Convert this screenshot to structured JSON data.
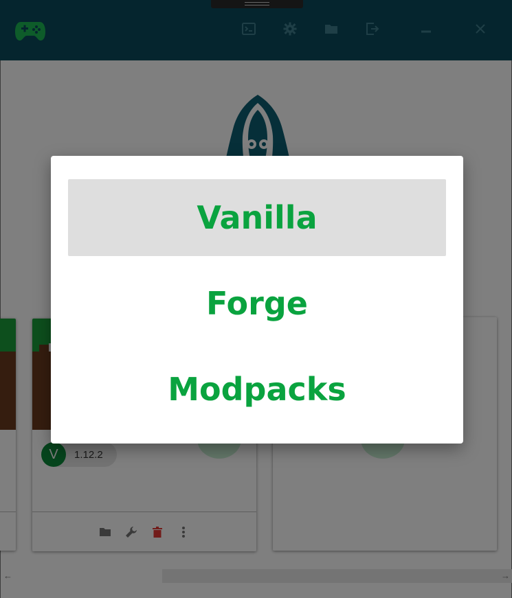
{
  "titlebar": {
    "icons": [
      "gamepad-icon",
      "terminal-icon",
      "gear-icon",
      "folder-icon",
      "logout-icon",
      "minimize-icon",
      "close-icon"
    ]
  },
  "instances": {
    "version_avatar": "V",
    "version": "1.12.2"
  },
  "dialog": {
    "options": [
      {
        "label": "Vanilla",
        "selected": true
      },
      {
        "label": "Forge",
        "selected": false
      },
      {
        "label": "Modpacks",
        "selected": false
      }
    ]
  },
  "colors": {
    "titlebar": "#0b4a5c",
    "accent_green": "#0aa33f",
    "selected_option_bg": "#dedede",
    "delete_red": "#e53935"
  }
}
